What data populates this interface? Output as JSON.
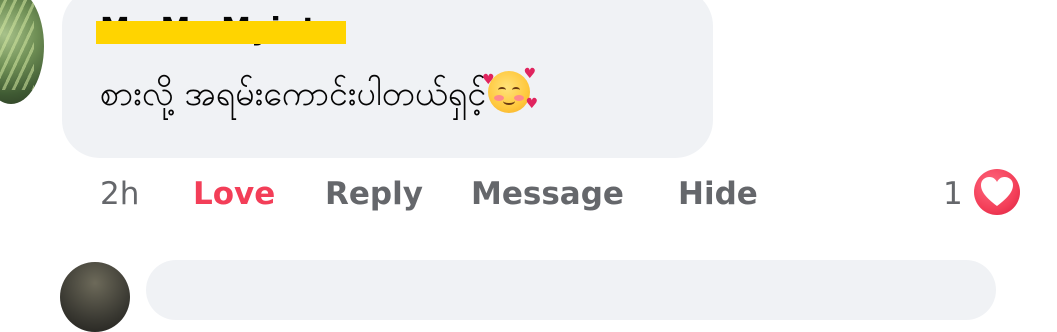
{
  "comment": {
    "author": "Ma Ma Myint",
    "text": "စားလို့ အရမ်းကောင်းပါတယ်ရှင့်",
    "emoji": "smiling-face-with-hearts"
  },
  "actions": {
    "time": "2h",
    "love": "Love",
    "reply": "Reply",
    "message": "Message",
    "hide": "Hide"
  },
  "reactions": {
    "count": "1",
    "type": "love",
    "color": "#f33e58"
  },
  "colors": {
    "bubble": "#f0f2f5",
    "muted_text": "#65676b",
    "love_accent": "#f33e58",
    "redaction": "#ffd400"
  }
}
